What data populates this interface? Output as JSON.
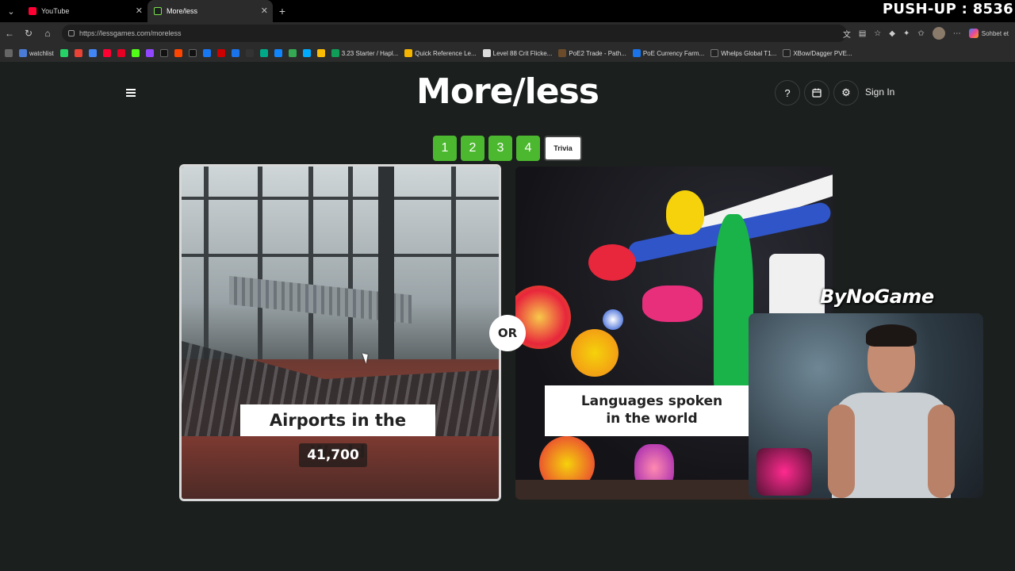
{
  "browser": {
    "tabs": [
      {
        "label": "YouTube",
        "active": false
      },
      {
        "label": "More/less",
        "active": true
      }
    ],
    "url": "https://lessgames.com/moreless",
    "profile_label": "Sohbet et",
    "bookmarks": [
      {
        "label": "watchlist"
      },
      {
        "label": "3.23 Starter / Hapl..."
      },
      {
        "label": "Quick Reference Le..."
      },
      {
        "label": "Level 88 Crit Flicke..."
      },
      {
        "label": "PoE2 Trade - Path..."
      },
      {
        "label": "PoE Currency Farm..."
      },
      {
        "label": "Whelps Global T1..."
      },
      {
        "label": "XBow/Dagger PVE..."
      }
    ]
  },
  "overlay": {
    "pushup_counter": "PUSH-UP : 8536",
    "watermark": "ByNoGame"
  },
  "header": {
    "logo": "More/less",
    "help_icon_label": "?",
    "sign_in": "Sign In"
  },
  "levels": {
    "items": [
      "1",
      "2",
      "3",
      "4"
    ],
    "trivia": "Trivia"
  },
  "left_card": {
    "title": "Airports in the World",
    "value": "41,700"
  },
  "right_card": {
    "title_line1": "Languages spoken",
    "title_line2": "in the world"
  },
  "or_label": "OR",
  "colors": {
    "level_green": "#4cb82f",
    "page_bg": "#1b1f1e",
    "youtube_red": "#ff0033"
  },
  "icons": [
    "hamburger-icon",
    "help-icon",
    "calendar-icon",
    "gear-icon",
    "back-icon",
    "reload-icon",
    "home-icon",
    "star-icon"
  ]
}
